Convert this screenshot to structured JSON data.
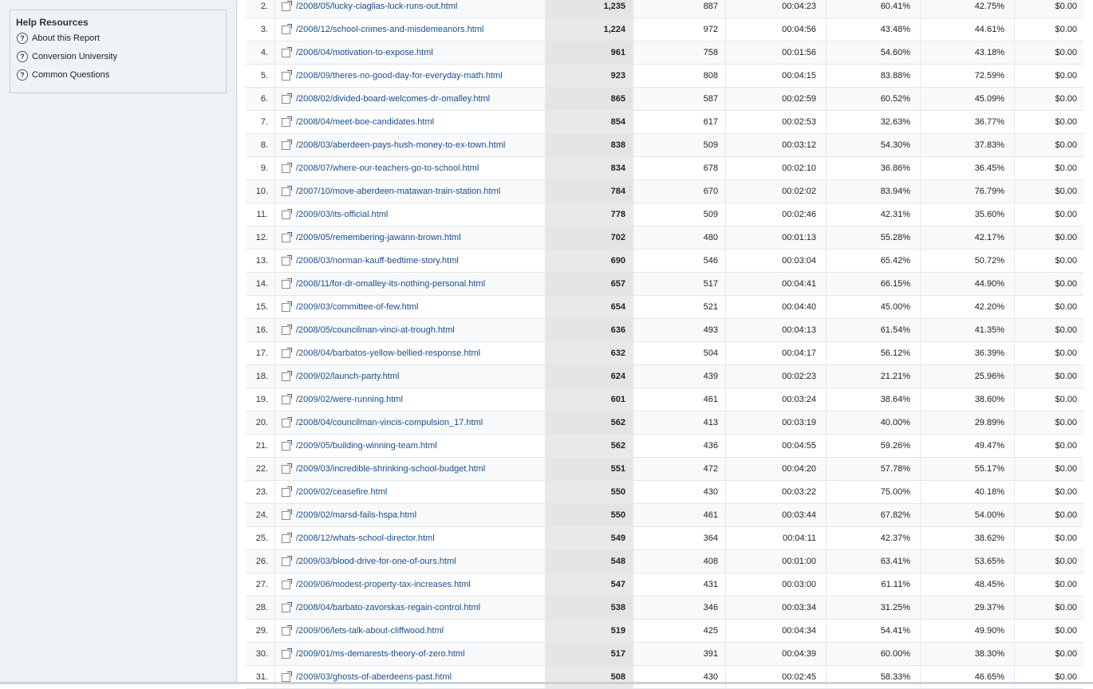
{
  "sidebar": {
    "help": {
      "title": "Help Resources",
      "items": [
        {
          "label": "About this Report"
        },
        {
          "label": "Conversion University"
        },
        {
          "label": "Common Questions"
        }
      ]
    }
  },
  "table": {
    "rows": [
      {
        "n": "2.",
        "page": "/2008/05/lucky-ciaglias-luck-runs-out.html",
        "pv": "1,235",
        "upv": "887",
        "time": "00:04:23",
        "entr": "60.41%",
        "exit": "42.75%",
        "idx": "$0.00"
      },
      {
        "n": "3.",
        "page": "/2008/12/school-crimes-and-misdemeanors.html",
        "pv": "1,224",
        "upv": "972",
        "time": "00:04:56",
        "entr": "43.48%",
        "exit": "44.61%",
        "idx": "$0.00"
      },
      {
        "n": "4.",
        "page": "/2008/04/motivation-to-expose.html",
        "pv": "961",
        "upv": "758",
        "time": "00:01:56",
        "entr": "54.60%",
        "exit": "43.18%",
        "idx": "$0.00"
      },
      {
        "n": "5.",
        "page": "/2008/09/theres-no-good-day-for-everyday-math.html",
        "pv": "923",
        "upv": "808",
        "time": "00:04:15",
        "entr": "83.88%",
        "exit": "72.59%",
        "idx": "$0.00"
      },
      {
        "n": "6.",
        "page": "/2008/02/divided-board-welcomes-dr-omalley.html",
        "pv": "865",
        "upv": "587",
        "time": "00:02:59",
        "entr": "60.52%",
        "exit": "45.09%",
        "idx": "$0.00"
      },
      {
        "n": "7.",
        "page": "/2008/04/meet-boe-candidates.html",
        "pv": "854",
        "upv": "617",
        "time": "00:02:53",
        "entr": "32.63%",
        "exit": "36.77%",
        "idx": "$0.00"
      },
      {
        "n": "8.",
        "page": "/2008/03/aberdeen-pays-hush-money-to-ex-town.html",
        "pv": "838",
        "upv": "509",
        "time": "00:03:12",
        "entr": "54.30%",
        "exit": "37.83%",
        "idx": "$0.00"
      },
      {
        "n": "9.",
        "page": "/2008/07/where-our-teachers-go-to-school.html",
        "pv": "834",
        "upv": "678",
        "time": "00:02:10",
        "entr": "36.86%",
        "exit": "36.45%",
        "idx": "$0.00"
      },
      {
        "n": "10.",
        "page": "/2007/10/move-aberdeen-matawan-train-station.html",
        "pv": "784",
        "upv": "670",
        "time": "00:02:02",
        "entr": "83.94%",
        "exit": "76.79%",
        "idx": "$0.00"
      },
      {
        "n": "11.",
        "page": "/2009/03/its-official.html",
        "pv": "778",
        "upv": "509",
        "time": "00:02:46",
        "entr": "42.31%",
        "exit": "35.60%",
        "idx": "$0.00"
      },
      {
        "n": "12.",
        "page": "/2009/05/remembering-jawann-brown.html",
        "pv": "702",
        "upv": "480",
        "time": "00:01:13",
        "entr": "55.28%",
        "exit": "42.17%",
        "idx": "$0.00"
      },
      {
        "n": "13.",
        "page": "/2008/03/norman-kauff-bedtime-story.html",
        "pv": "690",
        "upv": "546",
        "time": "00:03:04",
        "entr": "65.42%",
        "exit": "50.72%",
        "idx": "$0.00"
      },
      {
        "n": "14.",
        "page": "/2008/11/for-dr-omalley-its-nothing-personal.html",
        "pv": "657",
        "upv": "517",
        "time": "00:04:41",
        "entr": "66.15%",
        "exit": "44.90%",
        "idx": "$0.00"
      },
      {
        "n": "15.",
        "page": "/2009/03/committee-of-few.html",
        "pv": "654",
        "upv": "521",
        "time": "00:04:40",
        "entr": "45.00%",
        "exit": "42.20%",
        "idx": "$0.00"
      },
      {
        "n": "16.",
        "page": "/2008/05/councilman-vinci-at-trough.html",
        "pv": "636",
        "upv": "493",
        "time": "00:04:13",
        "entr": "61.54%",
        "exit": "41.35%",
        "idx": "$0.00"
      },
      {
        "n": "17.",
        "page": "/2008/04/barbatos-yellow-bellied-response.html",
        "pv": "632",
        "upv": "504",
        "time": "00:04:17",
        "entr": "56.12%",
        "exit": "36.39%",
        "idx": "$0.00"
      },
      {
        "n": "18.",
        "page": "/2009/02/launch-party.html",
        "pv": "624",
        "upv": "439",
        "time": "00:02:23",
        "entr": "21.21%",
        "exit": "25.96%",
        "idx": "$0.00"
      },
      {
        "n": "19.",
        "page": "/2009/02/were-running.html",
        "pv": "601",
        "upv": "461",
        "time": "00:03:24",
        "entr": "38.64%",
        "exit": "38.60%",
        "idx": "$0.00"
      },
      {
        "n": "20.",
        "page": "/2008/04/councilman-vincis-compulsion_17.html",
        "pv": "562",
        "upv": "413",
        "time": "00:03:19",
        "entr": "40.00%",
        "exit": "29.89%",
        "idx": "$0.00"
      },
      {
        "n": "21.",
        "page": "/2009/05/building-winning-team.html",
        "pv": "562",
        "upv": "436",
        "time": "00:04:55",
        "entr": "59.26%",
        "exit": "49.47%",
        "idx": "$0.00"
      },
      {
        "n": "22.",
        "page": "/2009/03/incredible-shrinking-school-budget.html",
        "pv": "551",
        "upv": "472",
        "time": "00:04:20",
        "entr": "57.78%",
        "exit": "55.17%",
        "idx": "$0.00"
      },
      {
        "n": "23.",
        "page": "/2009/02/ceasefire.html",
        "pv": "550",
        "upv": "430",
        "time": "00:03:22",
        "entr": "75.00%",
        "exit": "40.18%",
        "idx": "$0.00"
      },
      {
        "n": "24.",
        "page": "/2009/02/marsd-fails-hspa.html",
        "pv": "550",
        "upv": "461",
        "time": "00:03:44",
        "entr": "67.82%",
        "exit": "54.00%",
        "idx": "$0.00"
      },
      {
        "n": "25.",
        "page": "/2008/12/whats-school-director.html",
        "pv": "549",
        "upv": "364",
        "time": "00:04:11",
        "entr": "42.37%",
        "exit": "38.62%",
        "idx": "$0.00"
      },
      {
        "n": "26.",
        "page": "/2009/03/blood-drive-for-one-of-ours.html",
        "pv": "548",
        "upv": "408",
        "time": "00:01:00",
        "entr": "63.41%",
        "exit": "53.65%",
        "idx": "$0.00"
      },
      {
        "n": "27.",
        "page": "/2009/06/modest-property-tax-increases.html",
        "pv": "547",
        "upv": "431",
        "time": "00:03:00",
        "entr": "61.11%",
        "exit": "48.45%",
        "idx": "$0.00"
      },
      {
        "n": "28.",
        "page": "/2008/04/barbato-zavorskas-regain-control.html",
        "pv": "538",
        "upv": "346",
        "time": "00:03:34",
        "entr": "31.25%",
        "exit": "29.37%",
        "idx": "$0.00"
      },
      {
        "n": "29.",
        "page": "/2009/06/lets-talk-about-cliffwood.html",
        "pv": "519",
        "upv": "425",
        "time": "00:04:34",
        "entr": "54.41%",
        "exit": "49.90%",
        "idx": "$0.00"
      },
      {
        "n": "30.",
        "page": "/2009/01/ms-demarests-theory-of-zero.html",
        "pv": "517",
        "upv": "391",
        "time": "00:04:39",
        "entr": "60.00%",
        "exit": "38.30%",
        "idx": "$0.00"
      },
      {
        "n": "31.",
        "page": "/2009/03/ghosts-of-aberdeens-past.html",
        "pv": "508",
        "upv": "430",
        "time": "00:02:45",
        "entr": "58.33%",
        "exit": "46.65%",
        "idx": "$0.00"
      }
    ]
  }
}
